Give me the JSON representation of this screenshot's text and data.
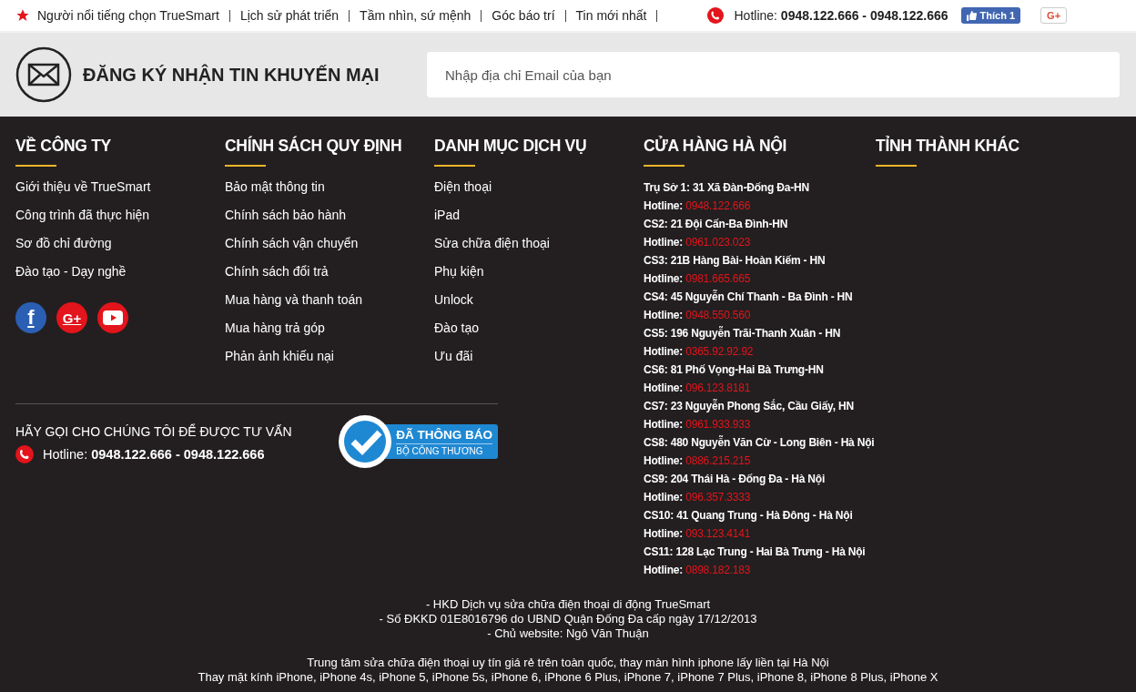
{
  "top_bar": {
    "links": [
      "Người nổi tiếng chọn TrueSmart",
      "Lịch sử phát triển",
      "Tầm nhìn, sứ mệnh",
      "Góc báo trí",
      "Tin mới nhất"
    ],
    "hotline_label": "Hotline:",
    "hotline_numbers": "0948.122.666 - 0948.122.666",
    "like_button": {
      "label": "Thích",
      "count": "1"
    },
    "gplus_button": "G+"
  },
  "subscribe": {
    "title": "ĐĂNG KÝ NHẬN TIN KHUYẾN MẠI",
    "placeholder": "Nhập địa chỉ Email của bạn"
  },
  "footer": {
    "columns": [
      {
        "kind": "links",
        "heading": "VỀ CÔNG TY",
        "items": [
          "Giới thiệu về TrueSmart",
          "Công trình đã thực hiện",
          "Sơ đồ chỉ đường",
          "Đào tạo - Dạy nghề"
        ]
      },
      {
        "kind": "links",
        "heading": "CHÍNH SÁCH QUY ĐỊNH",
        "items": [
          "Bảo mật thông tin",
          "Chính sách bảo hành",
          "Chính sách vận chuyển",
          "Chính sách đổi trả",
          "Mua hàng và thanh toán",
          "Mua hàng trả góp",
          "Phản ảnh khiếu nại"
        ]
      },
      {
        "kind": "links",
        "heading": "DANH MỤC DỊCH VỤ",
        "items": [
          "Điện thoại",
          "iPad",
          "Sửa chữa điện thoại",
          "Phụ kiện",
          "Unlock",
          "Đào tạo",
          "Ưu đãi"
        ]
      },
      {
        "kind": "stores",
        "heading": "CỬA HÀNG HÀ NỘI",
        "items": [
          {
            "address": "Trụ Sở 1: 31 Xã Đàn-Đống Đa-HN",
            "label": "Hotline:",
            "phone": "0948.122.666"
          },
          {
            "address": "CS2: 21 Đội Cấn-Ba Đình-HN",
            "label": "Hotline:",
            "phone": "0961.023.023"
          },
          {
            "address": "CS3: 21B Hàng Bài- Hoàn Kiếm - HN",
            "label": "Hotline:",
            "phone": "0981.665.665"
          },
          {
            "address": "CS4: 45 Nguyễn Chí Thanh - Ba Đình - HN",
            "label": "Hotline:",
            "phone": "0948.550.560"
          },
          {
            "address": "CS5: 196 Nguyễn Trãi-Thanh Xuân - HN",
            "label": "Hotline:",
            "phone": "0365.92.92.92"
          },
          {
            "address": "CS6: 81 Phố Vọng-Hai Bà Trưng-HN",
            "label": "Hotline:",
            "phone": "096.123.8181"
          },
          {
            "address": "CS7: 23 Nguyễn Phong Sắc, Cầu Giấy, HN",
            "label": "Hotline:",
            "phone": "0961.933.933"
          },
          {
            "address": "CS8: 480 Nguyễn Văn Cừ - Long Biên - Hà Nội",
            "label": "Hotline:",
            "phone": "0886.215.215"
          },
          {
            "address": "CS9: 204 Thái Hà - Đống Đa - Hà Nội",
            "label": "Hotline:",
            "phone": "096.357.3333"
          },
          {
            "address": "CS10: 41 Quang Trung - Hà Đông - Hà Nội",
            "label": "Hotline:",
            "phone": "093.123.4141"
          },
          {
            "address": "CS11: 128 Lạc Trung - Hai Bà Trưng - Hà Nội",
            "label": "Hotline:",
            "phone": "0898.182.183"
          }
        ]
      },
      {
        "kind": "links",
        "heading": "TỈNH THÀNH KHÁC"
      }
    ],
    "social": [
      {
        "kind": "facebook",
        "glyph": "f"
      },
      {
        "kind": "googleplus",
        "glyph": "G+"
      },
      {
        "kind": "youtube"
      }
    ],
    "call": {
      "title": "HÃY GỌI CHO CHÚNG TÔI ĐỂ ĐƯỢC TƯ VẤN",
      "label": "Hotline:",
      "numbers": "0948.122.666 - 0948.122.666"
    },
    "badge": {
      "title": "ĐÃ THÔNG BÁO",
      "subtitle": "BỘ CÔNG THƯƠNG"
    },
    "legal": [
      "- HKD Dịch vụ sửa chữa điện thoại di động TrueSmart",
      "- Số ĐKKD 01E8016796 do UBND Quận Đống Đa cấp ngày 17/12/2013",
      "- Chủ website: Ngô Văn Thuận"
    ],
    "about": [
      "Trung tâm sửa chữa điện thoại uy tín giá rẻ trên toàn quốc, thay màn hình iphone lấy liền tại Hà Nội",
      "Thay mặt kính iPhone, iPhone 4s, iPhone 5, iPhone 5s, iPhone 6, iPhone 6 Plus, iPhone 7, iPhone 7 Plus, iPhone 8, iPhone 8 Plus, iPhone X"
    ]
  }
}
